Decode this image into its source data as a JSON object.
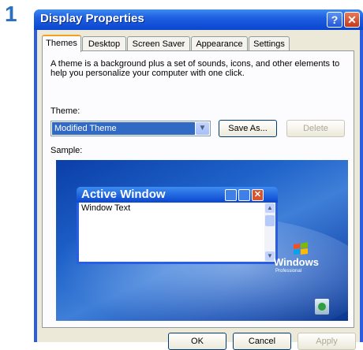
{
  "step_number": "1",
  "window": {
    "title": "Display Properties",
    "help_label": "?",
    "close_label": "✕"
  },
  "tabs": [
    {
      "label": "Themes",
      "active": true
    },
    {
      "label": "Desktop"
    },
    {
      "label": "Screen Saver"
    },
    {
      "label": "Appearance"
    },
    {
      "label": "Settings"
    }
  ],
  "themes_tab": {
    "description": "A theme is a background plus a set of sounds, icons, and other elements to help you personalize your computer with one click.",
    "theme_label": "Theme:",
    "theme_value": "Modified Theme",
    "save_as_label": "Save As...",
    "delete_label": "Delete",
    "sample_label": "Sample:"
  },
  "sample_preview": {
    "active_window_title": "Active Window",
    "window_text": "Window Text",
    "logo_text": "Windows",
    "logo_subtext": "Professional"
  },
  "footer": {
    "ok_label": "OK",
    "cancel_label": "Cancel",
    "apply_label": "Apply"
  },
  "colors": {
    "title_bar": "#0a46d0",
    "selection": "#316ac5",
    "step_number": "#2a6fc0",
    "desktop": "#1e62c9"
  }
}
